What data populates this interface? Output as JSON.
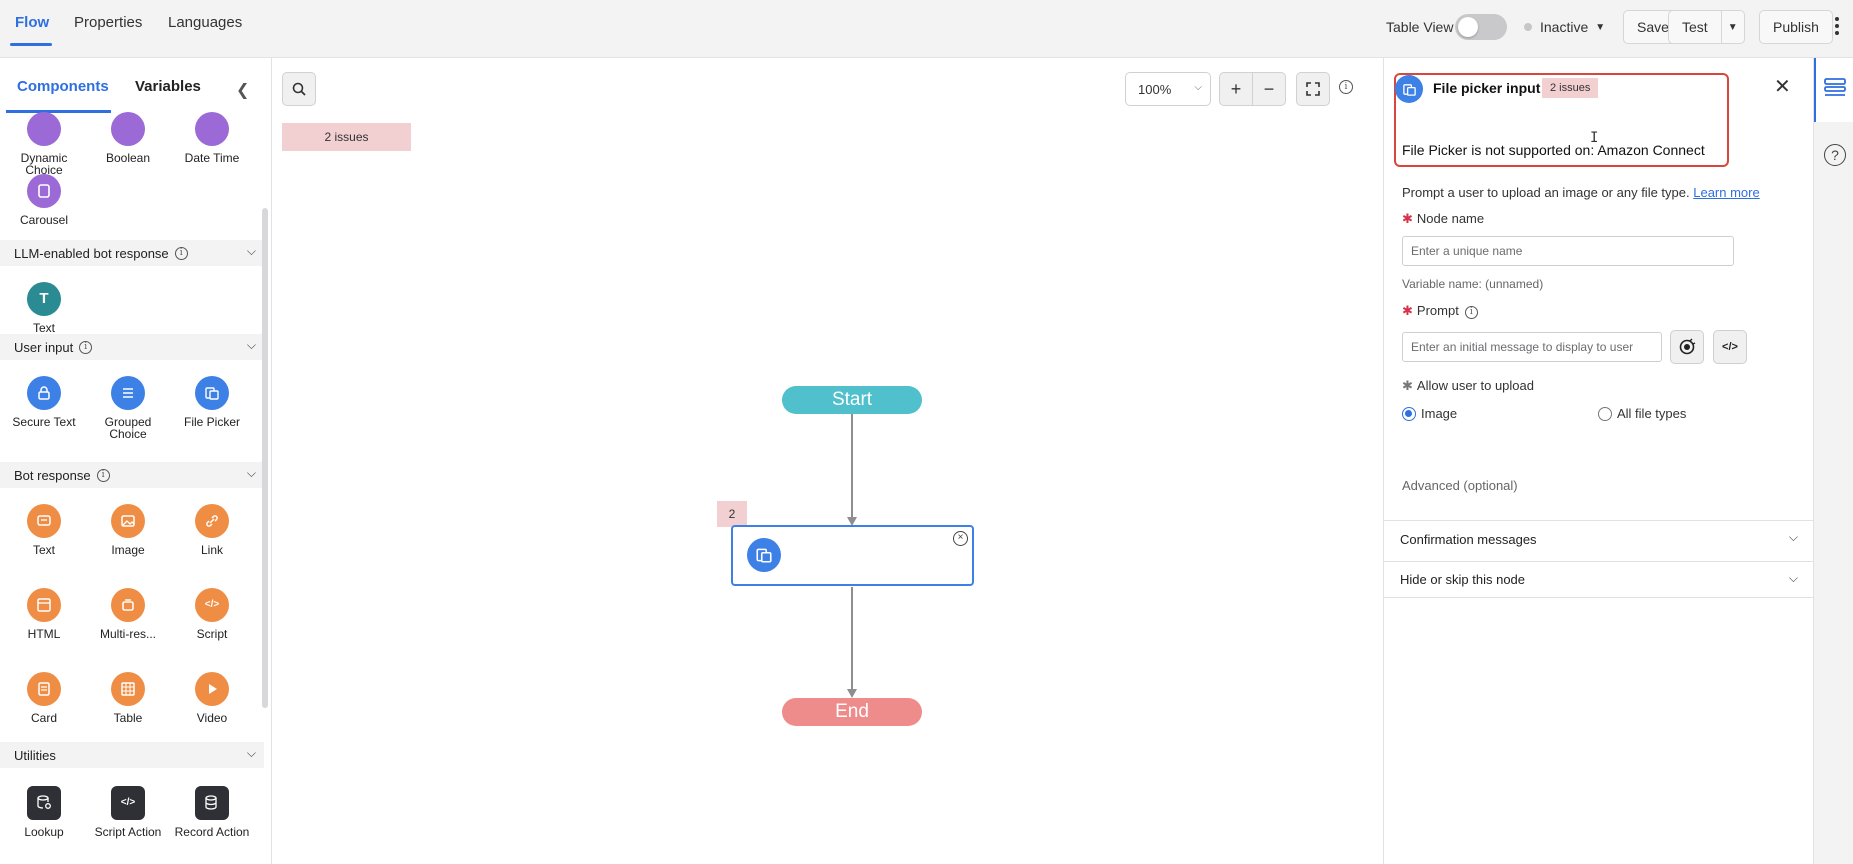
{
  "topbar": {
    "tabs": [
      "Flow",
      "Properties",
      "Languages"
    ],
    "table_view_label": "Table View",
    "status_label": "Inactive",
    "save_label": "Save",
    "test_label": "Test",
    "publish_label": "Publish"
  },
  "left_panel": {
    "tabs": [
      "Components",
      "Variables"
    ],
    "partial_row": [
      "Dynamic Choice",
      "Boolean",
      "Date Time"
    ],
    "carousel": "Carousel",
    "sections": [
      {
        "title": "LLM-enabled bot response",
        "items": [
          "Text"
        ]
      },
      {
        "title": "User input",
        "items": [
          "Secure Text",
          "Grouped Choice",
          "File Picker"
        ]
      },
      {
        "title": "Bot response",
        "items": [
          "Text",
          "Image",
          "Link",
          "HTML",
          "Multi-res...",
          "Script",
          "Card",
          "Table",
          "Video"
        ]
      },
      {
        "title": "Utilities",
        "items": [
          "Lookup",
          "Script Action",
          "Record Action"
        ]
      }
    ]
  },
  "canvas": {
    "zoom": "100%",
    "issues_banner": "2 issues",
    "start_label": "Start",
    "end_label": "End",
    "node_issue_count": "2"
  },
  "right_panel": {
    "title": "File picker input",
    "issues_badge": "2 issues",
    "alert_message": "File Picker is not supported on: Amazon Connect",
    "description": "Prompt a user to upload an image or any file type.",
    "learn_more": "Learn more",
    "node_name_label": "Node name",
    "node_name_placeholder": "Enter a unique name",
    "variable_name": "Variable name: (unnamed)",
    "prompt_label": "Prompt",
    "prompt_placeholder": "Enter an initial message to display to user",
    "allow_upload_label": "Allow user to upload",
    "options": [
      "Image",
      "All file types"
    ],
    "selected_option": "Image",
    "advanced_label": "Advanced (optional)",
    "accordions": [
      "Confirmation messages",
      "Hide or skip this node"
    ]
  },
  "colors": {
    "accent": "#2f6fe0",
    "error_border": "#d9473c",
    "issue_bg": "#f2cfd0",
    "start_node": "#4fc0cc",
    "end_node": "#ee8b8b"
  }
}
